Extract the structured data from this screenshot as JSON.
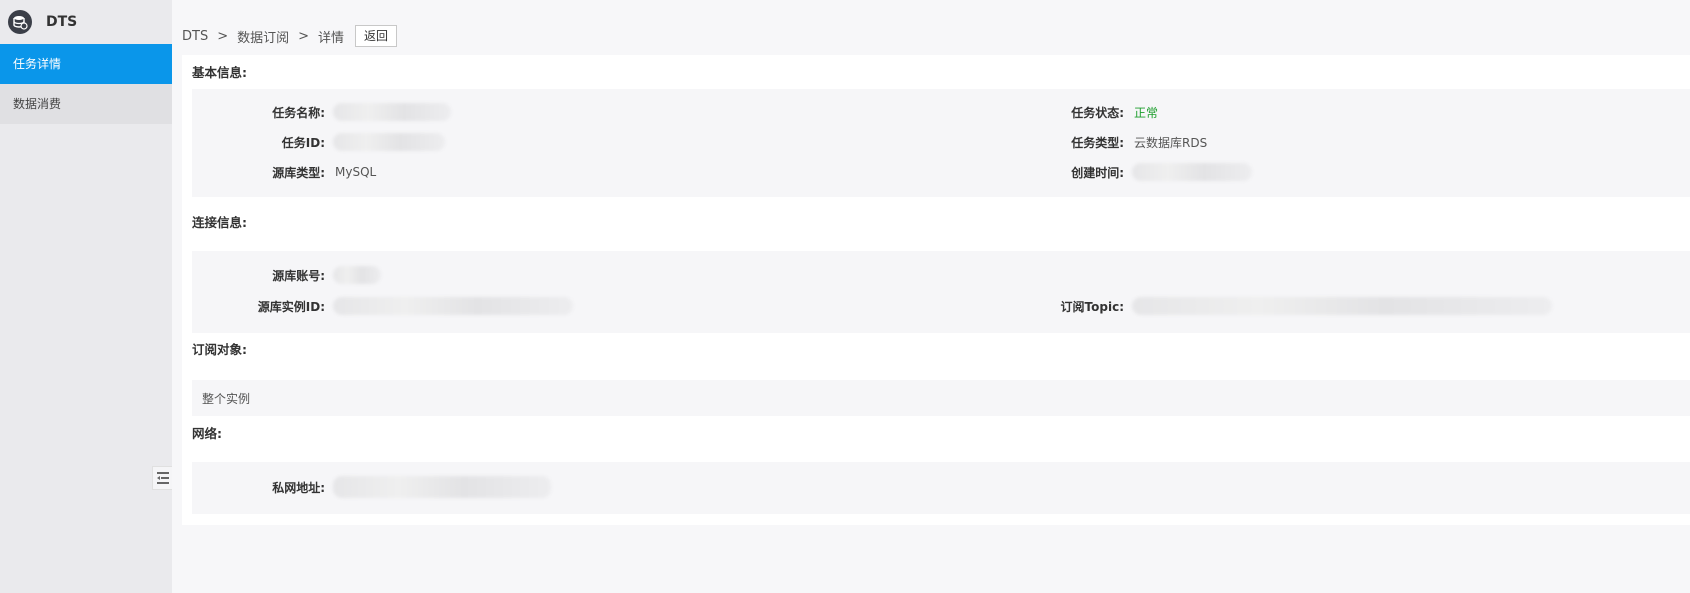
{
  "brand": {
    "name": "DTS",
    "logo_icon": "database-icon"
  },
  "sidebar": {
    "items": [
      {
        "label": "任务详情",
        "active": true
      },
      {
        "label": "数据消费",
        "active": false
      }
    ]
  },
  "breadcrumb": {
    "items": [
      "DTS",
      "数据订阅",
      "详情"
    ],
    "separator": ">",
    "back_label": "返回"
  },
  "sections": {
    "basic": {
      "title": "基本信息:",
      "task_name_label": "任务名称:",
      "task_id_label": "任务ID:",
      "source_type_label": "源库类型:",
      "source_type_value": "MySQL",
      "task_status_label": "任务状态:",
      "task_status_value": "正常",
      "task_type_label": "任务类型:",
      "task_type_value": "云数据库RDS",
      "created_time_label": "创建时间:"
    },
    "connection": {
      "title": "连接信息:",
      "source_account_label": "源库账号:",
      "source_instance_label": "源库实例ID:",
      "topic_label": "订阅Topic:"
    },
    "subscription": {
      "title": "订阅对象:",
      "value": "整个实例"
    },
    "network": {
      "title": "网络:",
      "private_address_label": "私网地址:"
    }
  },
  "colors": {
    "accent": "#0a96ea",
    "status_ok": "#1e9f2e"
  }
}
